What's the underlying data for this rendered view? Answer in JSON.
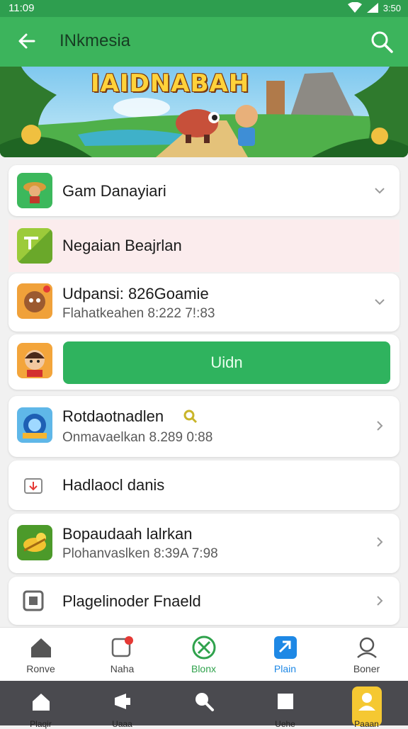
{
  "status_bar": {
    "time": "11:09",
    "battery": "3:50"
  },
  "app_bar": {
    "title": "INkmesia"
  },
  "banner": {
    "title": "IAIDNABAH"
  },
  "list": [
    {
      "title": "Gam Danayiari"
    },
    {
      "title": "Negaian Beajrlan"
    },
    {
      "title": "Udpansi: 826Goamie",
      "subtitle": "Flahatkeahen 8:222 7!:83"
    },
    {
      "button_label": "Uidn"
    },
    {
      "title": "Rotdaotnadlen",
      "subtitle": "Onmavaelkan 8.289 0:88"
    },
    {
      "title": "Hadlaocl danis"
    },
    {
      "title": "Bopaudaah lalrkan",
      "subtitle": "Plohanvaslken 8:39A 7:98"
    },
    {
      "title": "Plagelinoder Fnaeld"
    }
  ],
  "tabs": [
    {
      "label": "Ronve"
    },
    {
      "label": "Naha"
    },
    {
      "label": "Blonx",
      "color": "#2fa24c"
    },
    {
      "label": "Plain",
      "color": "#1e88e5"
    },
    {
      "label": "Boner"
    }
  ],
  "bottom_nav": [
    {
      "label": "Plaqir"
    },
    {
      "label": "Uaaa"
    },
    {
      "label": ""
    },
    {
      "label": "Uehe"
    },
    {
      "label": "Paaan"
    }
  ]
}
